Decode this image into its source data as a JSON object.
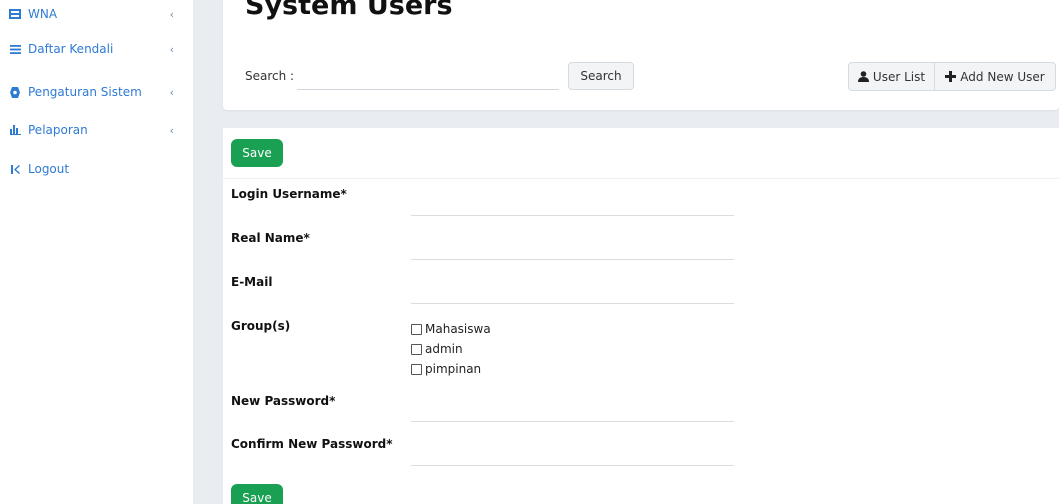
{
  "sidebar": {
    "items": [
      {
        "label": "WNA",
        "icon": "list-icon",
        "has_chevron": true
      },
      {
        "label": "Daftar Kendali",
        "icon": "menu-icon",
        "has_chevron": true
      },
      {
        "label": "Pengaturan Sistem",
        "icon": "gear-icon",
        "has_chevron": true
      },
      {
        "label": "Pelaporan",
        "icon": "bar-chart-icon",
        "has_chevron": true
      },
      {
        "label": "Logout",
        "icon": "logout-icon",
        "has_chevron": false
      }
    ],
    "chevron": "‹"
  },
  "header": {
    "title": "System Users",
    "search_label": "Search :",
    "search_value": "",
    "search_button": "Search",
    "user_list_button": "User List",
    "add_user_button": "Add New User"
  },
  "form": {
    "save_label": "Save",
    "fields": {
      "username": "Login Username*",
      "realname": "Real Name*",
      "email": "E-Mail",
      "groups": "Group(s)",
      "password": "New Password*",
      "confirm_password": "Confirm New Password*"
    },
    "groups": [
      {
        "label": "Mahasiswa",
        "checked": false
      },
      {
        "label": "admin",
        "checked": false
      },
      {
        "label": "pimpinan",
        "checked": false
      }
    ]
  },
  "colors": {
    "accent": "#2e7bd4",
    "save": "#1aa053",
    "background": "#e9edf1"
  }
}
